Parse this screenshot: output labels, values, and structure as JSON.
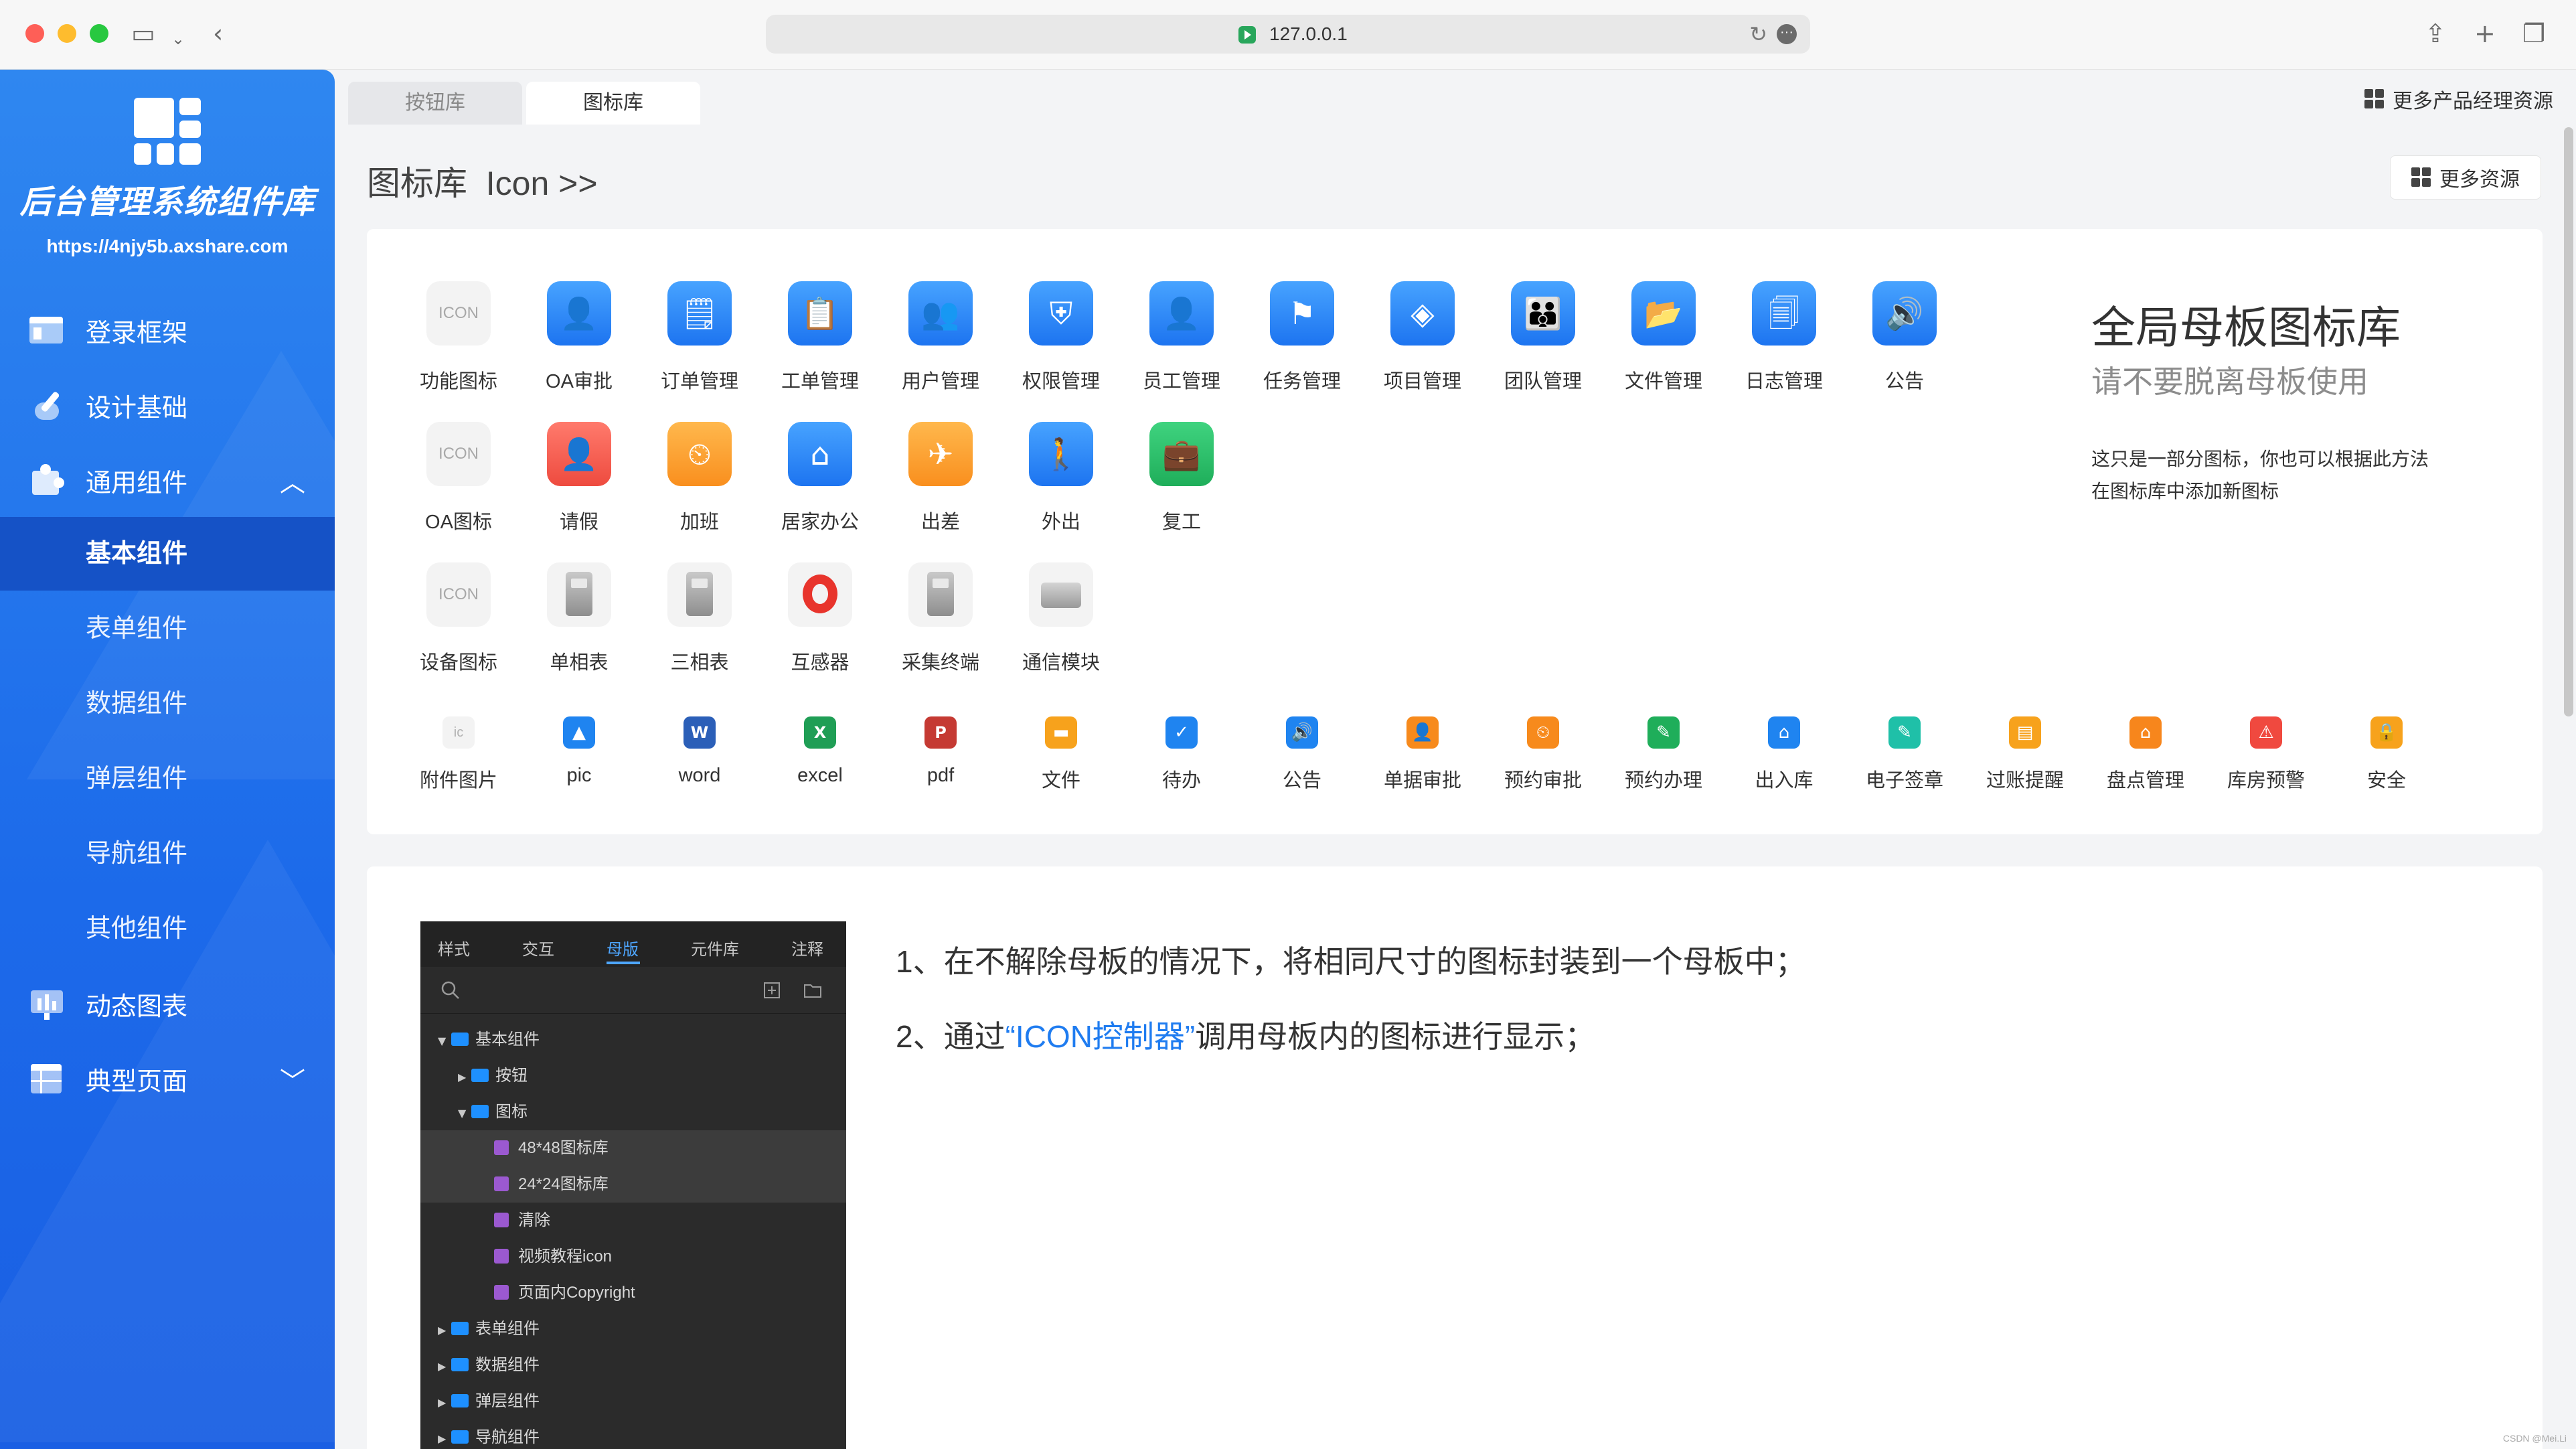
{
  "browser": {
    "url": "127.0.0.1"
  },
  "sidebar": {
    "brand_title": "后台管理系统组件库",
    "brand_url": "https://4njy5b.axshare.com",
    "items": [
      {
        "label": "登录框架",
        "icon": "layout-icon"
      },
      {
        "label": "设计基础",
        "icon": "brush-icon"
      },
      {
        "label": "通用组件",
        "icon": "puzzle-icon",
        "chevron": "^"
      },
      {
        "label": "动态图表",
        "icon": "chart-icon"
      },
      {
        "label": "典型页面",
        "icon": "table-icon",
        "chevron": "v"
      }
    ],
    "sub_items": [
      "基本组件",
      "表单组件",
      "数据组件",
      "弹层组件",
      "导航组件",
      "其他组件"
    ]
  },
  "tabs": [
    "按钮库",
    "图标库"
  ],
  "top_resource": "更多产品经理资源",
  "heading": "图标库  Icon >>",
  "more_button": "更多资源",
  "icons": {
    "row1": [
      {
        "label": "功能图标",
        "tile": "ICON"
      },
      {
        "label": "OA审批"
      },
      {
        "label": "订单管理"
      },
      {
        "label": "工单管理"
      },
      {
        "label": "用户管理"
      },
      {
        "label": "权限管理"
      },
      {
        "label": "员工管理"
      },
      {
        "label": "任务管理"
      },
      {
        "label": "项目管理"
      },
      {
        "label": "团队管理"
      },
      {
        "label": "文件管理"
      },
      {
        "label": "日志管理"
      },
      {
        "label": "公告"
      }
    ],
    "row2": [
      {
        "label": "OA图标",
        "tile": "ICON"
      },
      {
        "label": "请假"
      },
      {
        "label": "加班"
      },
      {
        "label": "居家办公"
      },
      {
        "label": "出差"
      },
      {
        "label": "外出"
      },
      {
        "label": "复工"
      }
    ],
    "row3": [
      {
        "label": "设备图标",
        "tile": "ICON"
      },
      {
        "label": "单相表"
      },
      {
        "label": "三相表"
      },
      {
        "label": "互感器"
      },
      {
        "label": "采集终端"
      },
      {
        "label": "通信模块"
      }
    ],
    "row4": [
      {
        "label": "附件图片",
        "tile": "ic"
      },
      {
        "label": "pic"
      },
      {
        "label": "word"
      },
      {
        "label": "excel"
      },
      {
        "label": "pdf"
      },
      {
        "label": "文件"
      },
      {
        "label": "待办"
      },
      {
        "label": "公告"
      },
      {
        "label": "单据审批"
      },
      {
        "label": "预约审批"
      },
      {
        "label": "预约办理"
      },
      {
        "label": "出入库"
      },
      {
        "label": "电子签章"
      },
      {
        "label": "过账提醒"
      },
      {
        "label": "盘点管理"
      },
      {
        "label": "库房预警"
      },
      {
        "label": "安全"
      }
    ]
  },
  "side_note": {
    "title": "全局母板图标库",
    "subtitle": "请不要脱离母板使用",
    "desc": "这只是一部分图标，你也可以根据此方法在图标库中添加新图标"
  },
  "dark_panel": {
    "tabs": [
      "样式",
      "交互",
      "母版",
      "元件库",
      "注释"
    ],
    "tree": [
      {
        "label": "基本组件",
        "type": "folder",
        "level": 0,
        "arrow": "▼"
      },
      {
        "label": "按钮",
        "type": "folder",
        "level": 1,
        "arrow": "▶"
      },
      {
        "label": "图标",
        "type": "folder",
        "level": 1,
        "arrow": "▼"
      },
      {
        "label": "48*48图标库",
        "type": "page",
        "level": 2,
        "selected": true
      },
      {
        "label": "24*24图标库",
        "type": "page",
        "level": 2,
        "selected": true
      },
      {
        "label": "清除",
        "type": "page",
        "level": 2
      },
      {
        "label": "视频教程icon",
        "type": "page",
        "level": 2
      },
      {
        "label": "页面内Copyright",
        "type": "page",
        "level": 2
      },
      {
        "label": "表单组件",
        "type": "folder",
        "level": 0,
        "arrow": "▶"
      },
      {
        "label": "数据组件",
        "type": "folder",
        "level": 0,
        "arrow": "▶"
      },
      {
        "label": "弹层组件",
        "type": "folder",
        "level": 0,
        "arrow": "▶"
      },
      {
        "label": "导航组件",
        "type": "folder",
        "level": 0,
        "arrow": "▶"
      }
    ]
  },
  "steps": {
    "step1": "1、在不解除母板的情况下，将相同尺寸的图标封装到一个母板中；",
    "step2_pre": "2、通过",
    "step2_hl": "“ICON控制器”",
    "step2_post": "调用母板内的图标进行显示；"
  },
  "watermark": "CSDN @Mei.Li",
  "colors": {
    "sidebar": "#1c6aea",
    "accent": "#1f7cf0",
    "dark_panel": "#2b2b2b"
  }
}
